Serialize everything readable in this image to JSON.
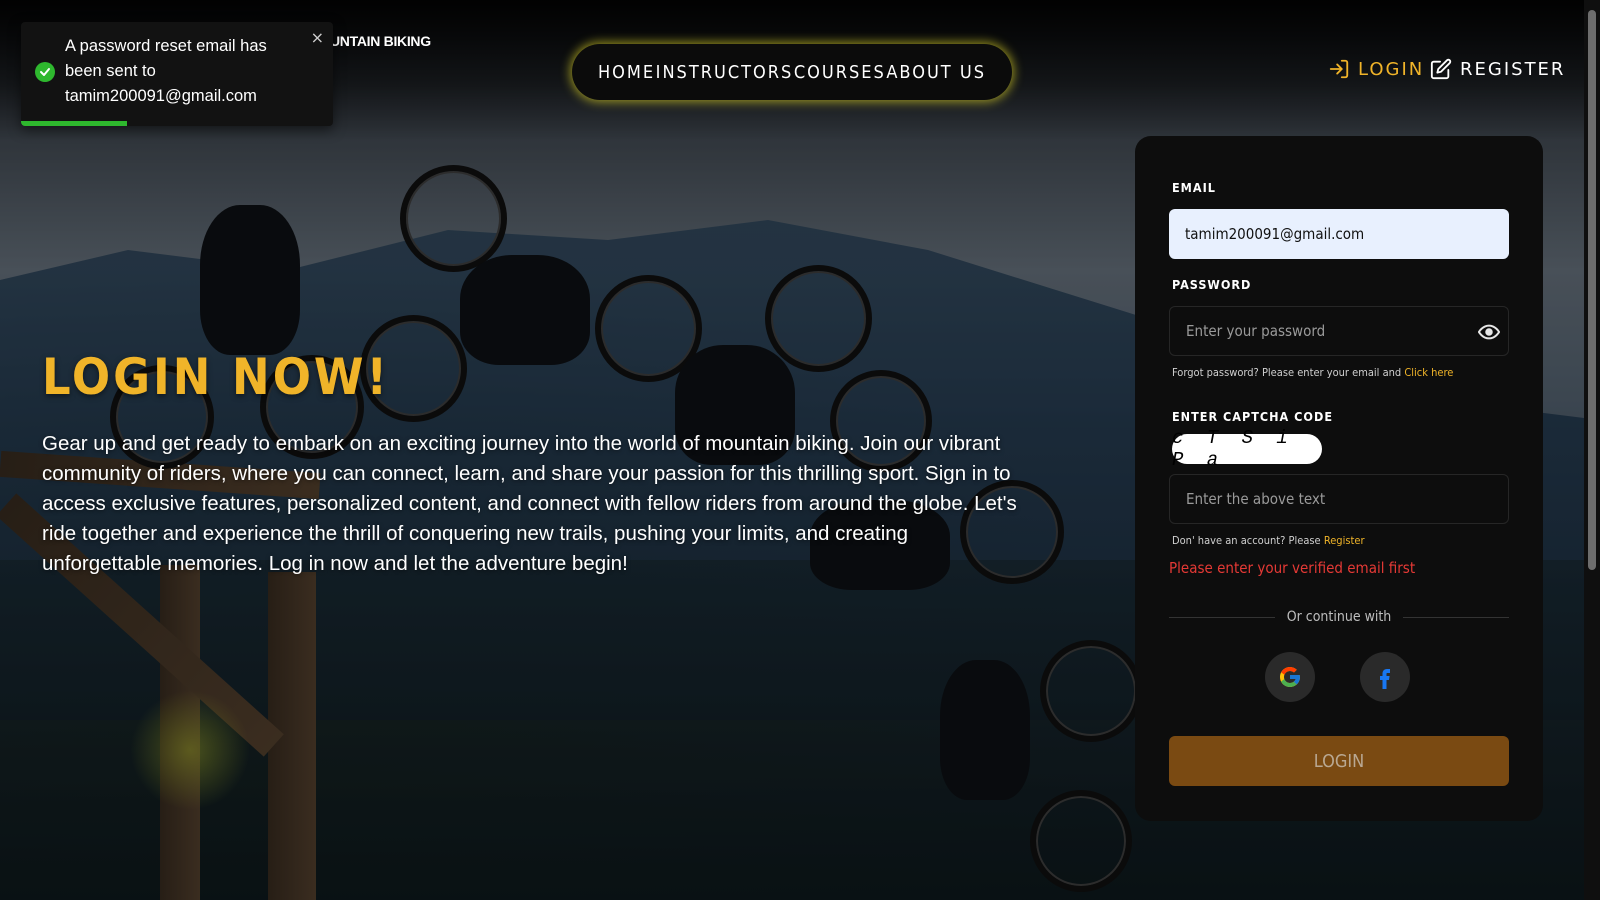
{
  "brand": {
    "name": "UNTAIN BIKING"
  },
  "nav": {
    "links": [
      "HOME",
      "INSTRUCTORS",
      "COURSES",
      "ABOUT US"
    ],
    "login_label": "LOGIN",
    "register_label": "REGISTER"
  },
  "toast": {
    "message": "A password reset email has been sent to tamim200091@gmail.com",
    "close_glyph": "×",
    "progress": 0.34,
    "status_color": "#2eb82e"
  },
  "hero": {
    "title": "LOGIN NOW!",
    "text": "Gear up and get ready to embark on an exciting journey into the world of mountain biking. Join our vibrant community of riders, where you can connect, learn, and share your passion for this thrilling sport. Sign in to access exclusive features, personalized content, and connect with fellow riders from around the globe. Let's ride together and experience the thrill of conquering new trails, pushing your limits, and creating unforgettable memories. Log in now and let the adventure begin!"
  },
  "form": {
    "email_label": "EMAIL",
    "email_value": "tamim200091@gmail.com",
    "password_label": "PASSWORD",
    "password_placeholder": "Enter your password",
    "forgot_text": "Forgot password? Please enter your email and",
    "forgot_link": "Click here",
    "captcha_label": "ENTER CAPTCHA CODE",
    "captcha_code": "c T S i P a",
    "captcha_placeholder": "Enter the above text",
    "no_account_text": "Don' have an account? Please",
    "register_link": "Register",
    "error": "Please enter your verified email first",
    "divider_text": "Or continue with",
    "submit_label": "LOGIN"
  },
  "icons": {
    "toast_status": "check-circle-icon",
    "close": "close-icon",
    "login": "login-arrow-icon",
    "register": "edit-square-icon",
    "password_toggle": "eye-icon",
    "google": "google-icon",
    "facebook": "facebook-icon"
  },
  "colors": {
    "accent": "#f0b429",
    "error": "#e53935",
    "button": "#7a4a12",
    "card": "#0d0d0d"
  }
}
